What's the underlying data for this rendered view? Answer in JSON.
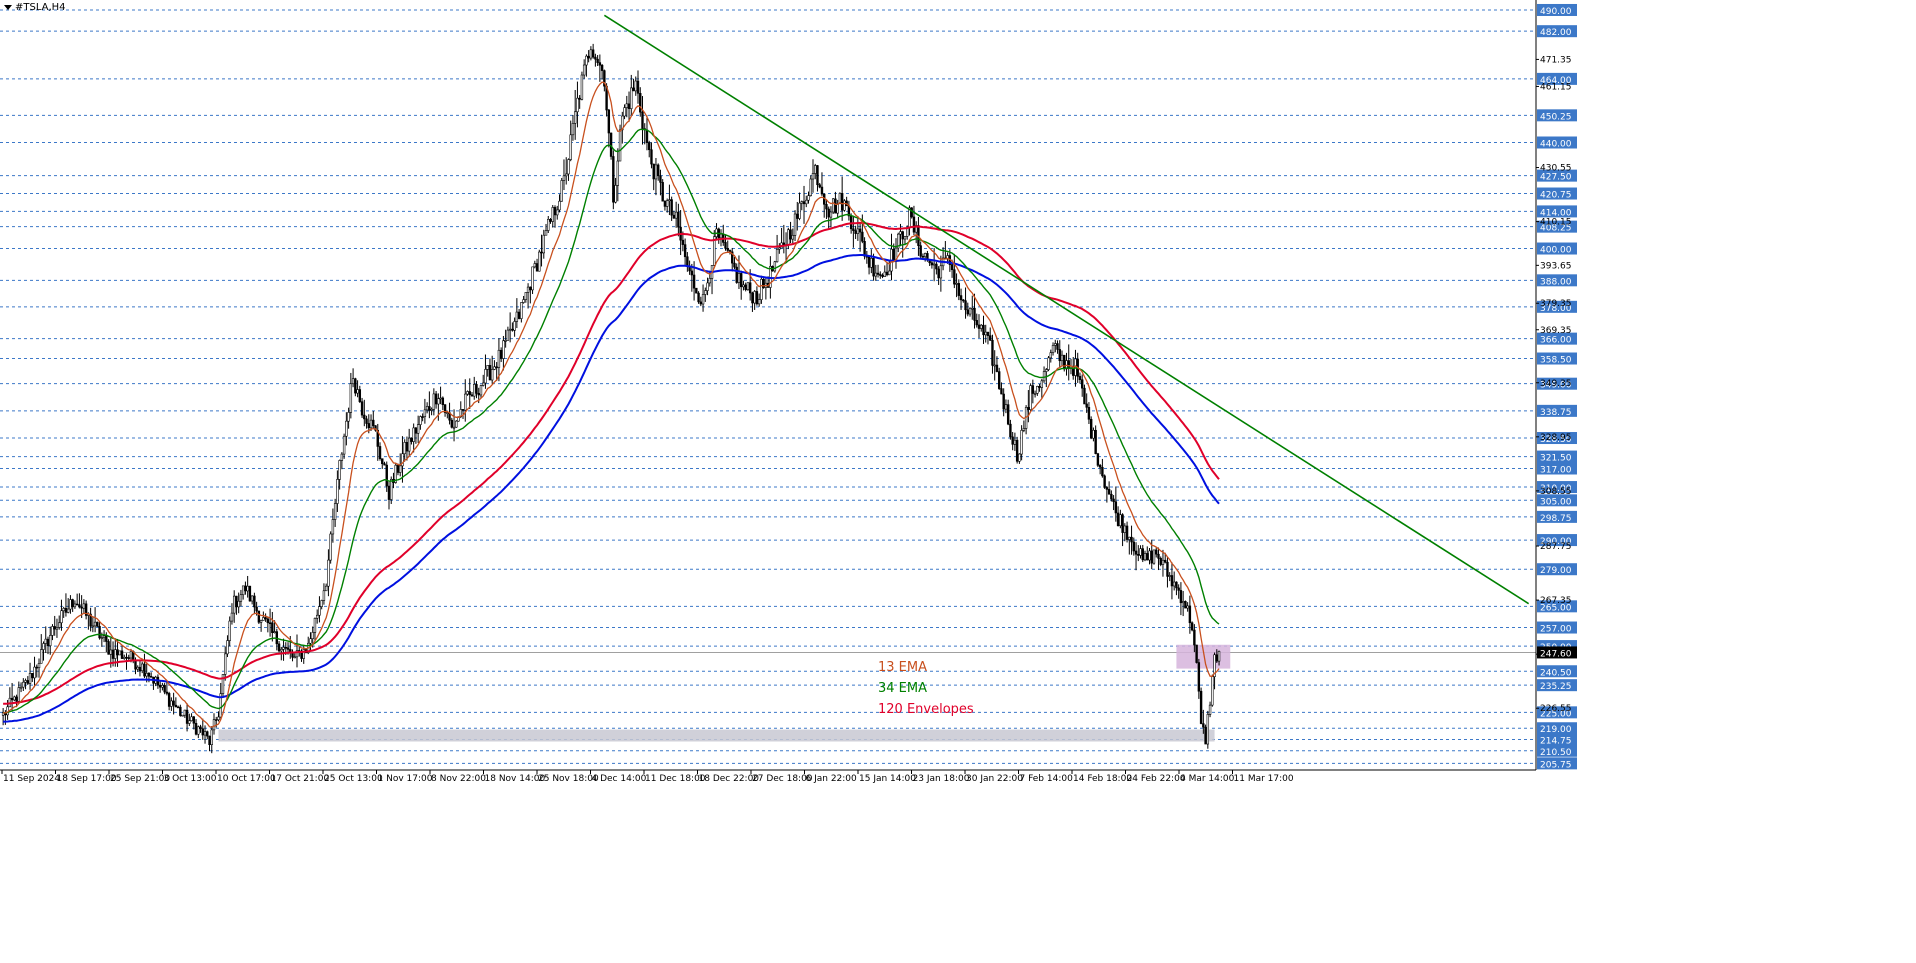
{
  "window": {
    "symbol_title": "#TSLA,H4"
  },
  "colors": {
    "background": "#ffffff",
    "bull_candle": "#000000",
    "bear_candle": "#000000",
    "ema13": "#c8501e",
    "ema34": "#008000",
    "env_upper": "#e0002a",
    "env_lower": "#0010e0",
    "trendline": "#008000",
    "grid": "#3c78c8",
    "label_bg": "#3c78c8",
    "current_bg": "#000000",
    "zone_support": "#c8c8d2",
    "zone_current": "#d6b4dc"
  },
  "legend": {
    "ema13_label": "13 EMA",
    "ema34_label": "34 EMA",
    "envelopes_label": "120 Envelopes"
  },
  "chart_data": {
    "type": "candlestick",
    "title": "#TSLA,H4",
    "ylim": [
      205.75,
      490.0
    ],
    "current_price": 247.6,
    "x_tick_labels": [
      "11 Sep 2024",
      "18 Sep 17:00",
      "25 Sep 21:00",
      "3 Oct 13:00",
      "10 Oct 17:00",
      "17 Oct 21:00",
      "25 Oct 13:00",
      "1 Nov 17:00",
      "8 Nov 22:00",
      "18 Nov 14:00",
      "25 Nov 18:00",
      "4 Dec 14:00",
      "11 Dec 18:00",
      "18 Dec 22:00",
      "27 Dec 18:00",
      "6 Jan 22:00",
      "15 Jan 14:00",
      "23 Jan 18:00",
      "30 Jan 22:00",
      "7 Feb 14:00",
      "14 Feb 18:00",
      "24 Feb 22:00",
      "4 Mar 14:00",
      "11 Mar 17:00"
    ],
    "y_grid_levels": [
      490.0,
      482.0,
      464.0,
      450.25,
      440.0,
      427.5,
      420.75,
      414.0,
      408.25,
      400.0,
      388.0,
      378.0,
      366.0,
      358.5,
      349.0,
      338.75,
      328.5,
      321.5,
      317.0,
      310.0,
      305.0,
      298.75,
      290.0,
      279.0,
      265.0,
      257.0,
      250.0,
      240.5,
      235.25,
      225.0,
      219.0,
      214.75,
      210.5,
      205.75
    ],
    "y_plain_ticks": [
      471.35,
      461.15,
      430.55,
      410.15,
      393.65,
      379.35,
      369.35,
      349.35,
      328.95,
      308.55,
      287.75,
      267.35,
      246.95,
      226.55
    ],
    "anchors": [
      [
        0,
        224
      ],
      [
        12,
        238
      ],
      [
        22,
        256
      ],
      [
        32,
        268
      ],
      [
        40,
        258
      ],
      [
        48,
        248
      ],
      [
        56,
        246
      ],
      [
        64,
        241
      ],
      [
        72,
        232
      ],
      [
        80,
        224
      ],
      [
        88,
        218
      ],
      [
        92,
        214
      ],
      [
        96,
        225
      ],
      [
        102,
        265
      ],
      [
        108,
        272
      ],
      [
        114,
        262
      ],
      [
        122,
        252
      ],
      [
        130,
        245
      ],
      [
        136,
        250
      ],
      [
        144,
        275
      ],
      [
        150,
        318
      ],
      [
        156,
        352
      ],
      [
        160,
        340
      ],
      [
        166,
        330
      ],
      [
        172,
        308
      ],
      [
        178,
        322
      ],
      [
        186,
        335
      ],
      [
        194,
        346
      ],
      [
        200,
        332
      ],
      [
        206,
        342
      ],
      [
        214,
        350
      ],
      [
        222,
        360
      ],
      [
        230,
        375
      ],
      [
        240,
        400
      ],
      [
        250,
        425
      ],
      [
        256,
        455
      ],
      [
        262,
        478
      ],
      [
        268,
        465
      ],
      [
        272,
        420
      ],
      [
        276,
        450
      ],
      [
        282,
        462
      ],
      [
        288,
        435
      ],
      [
        294,
        420
      ],
      [
        300,
        410
      ],
      [
        306,
        390
      ],
      [
        312,
        380
      ],
      [
        318,
        405
      ],
      [
        324,
        395
      ],
      [
        330,
        385
      ],
      [
        336,
        382
      ],
      [
        342,
        390
      ],
      [
        348,
        402
      ],
      [
        354,
        412
      ],
      [
        362,
        430
      ],
      [
        368,
        415
      ],
      [
        374,
        418
      ],
      [
        380,
        408
      ],
      [
        386,
        395
      ],
      [
        392,
        390
      ],
      [
        398,
        400
      ],
      [
        404,
        412
      ],
      [
        410,
        398
      ],
      [
        416,
        392
      ],
      [
        422,
        395
      ],
      [
        428,
        378
      ],
      [
        434,
        372
      ],
      [
        440,
        362
      ],
      [
        446,
        342
      ],
      [
        452,
        322
      ],
      [
        458,
        345
      ],
      [
        464,
        352
      ],
      [
        468,
        362
      ],
      [
        472,
        358
      ],
      [
        478,
        355
      ],
      [
        484,
        335
      ],
      [
        490,
        315
      ],
      [
        496,
        300
      ],
      [
        502,
        292
      ],
      [
        508,
        282
      ],
      [
        514,
        285
      ],
      [
        520,
        276
      ],
      [
        526,
        268
      ],
      [
        530,
        258
      ],
      [
        532,
        242
      ],
      [
        534,
        220
      ],
      [
        536,
        215
      ],
      [
        538,
        230
      ],
      [
        540,
        245
      ],
      [
        542,
        248
      ]
    ],
    "ema_periods": {
      "fast": 13,
      "medium": 34,
      "envelope": 120
    },
    "envelope_deviation_pct": 1.5,
    "trendline": {
      "from": {
        "bar": 268,
        "price": 488
      },
      "to": {
        "bar": 680,
        "price": 266
      }
    },
    "zones": [
      {
        "name": "support",
        "bar_from": 96,
        "bar_to": 540,
        "price_from": 214,
        "price_to": 218.5
      },
      {
        "name": "current",
        "bar_from": 523,
        "bar_to": 547,
        "price_from": 241.5,
        "price_to": 250.5
      }
    ]
  }
}
